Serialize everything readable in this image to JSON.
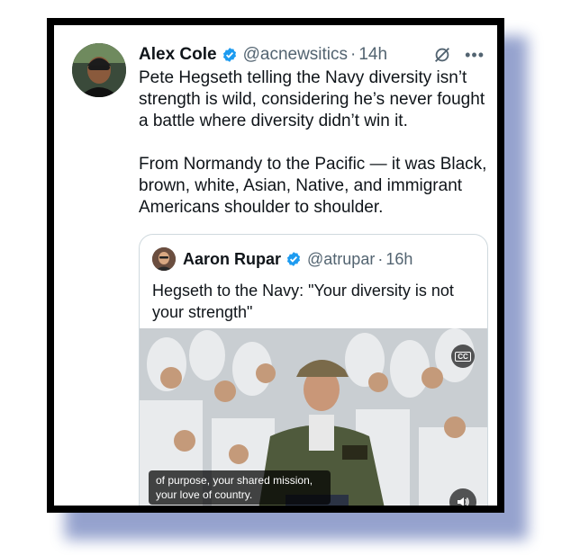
{
  "tweet": {
    "author_name": "Alex Cole",
    "handle": "@acnewsitics",
    "separator": "·",
    "time": "14h",
    "paragraphs": [
      "Pete Hegseth telling the Navy diversity isn’t strength is wild, considering he’s never fought a battle where diversity didn’t win it.",
      "From Normandy to the Pacific — it was Black, brown, white, Asian, Native, and immigrant Americans shoulder to shoulder."
    ],
    "icons": {
      "avatar": "avatar",
      "verified": "verified-badge-icon",
      "grok": "grok-icon",
      "more": "more-icon"
    }
  },
  "quoted_tweet": {
    "author_name": "Aaron Rupar",
    "handle": "@atrupar",
    "separator": "·",
    "time": "16h",
    "text": "Hegseth to the Navy: \"Your diversity is not your strength\"",
    "video": {
      "caption": "of purpose, your shared mission, your love of country.",
      "cc_label": "CC"
    }
  },
  "colors": {
    "verified": "#1d9bf0",
    "text": "#0f1419",
    "secondary": "#536471",
    "frame": "#000000",
    "shadow": "#3f57a6"
  }
}
